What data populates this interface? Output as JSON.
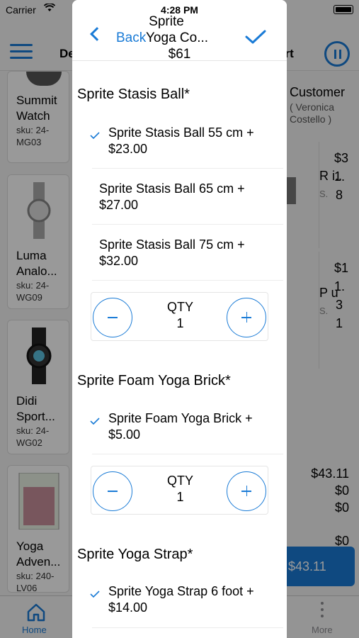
{
  "status_bar": {
    "carrier": "Carrier",
    "time": "4:28 PM"
  },
  "background": {
    "header": {
      "left_title_fragment": "De",
      "right_title_fragment": "art"
    },
    "products": [
      {
        "name_line1": "Summit",
        "name_line2": "Watch",
        "sku_line1": "sku: 24-",
        "sku_line2": "MG03"
      },
      {
        "name_line1": "Luma",
        "name_line2": "Analo...",
        "sku_line1": "sku: 24-",
        "sku_line2": "WG09"
      },
      {
        "name_line1": "Didi",
        "name_line2": "Sport...",
        "sku_line1": "sku: 24-",
        "sku_line2": "WG02"
      },
      {
        "name_line1": "Yoga",
        "name_line2": "Adven...",
        "sku_line1": "sku: 240-",
        "sku_line2": "LV06"
      }
    ],
    "customer": {
      "label": "Customer",
      "name_line1": "( Veronica",
      "name_line2": "Costello )"
    },
    "cart": {
      "item1_name": "R i..",
      "item1_sub": "S.",
      "item1_price": "$31.8",
      "item2_name": "P u",
      "item2_sub": "S.",
      "item2_price": "$11.31"
    },
    "totals": {
      "subtotal": "$43.11",
      "discount": "$0",
      "tax": "$0",
      "shipping": "$0"
    },
    "pay_button": "$43.11",
    "tabs": {
      "home": "Home",
      "more": "More"
    }
  },
  "sheet": {
    "back_label": "Back",
    "title_line1": "Sprite",
    "title_line2": "Yoga Co...",
    "title_price": "$61",
    "groups": [
      {
        "title": "Sprite Stasis Ball*",
        "options": [
          {
            "line1": "Sprite Stasis Ball 55 cm +",
            "line2": "$23.00",
            "selected": true
          },
          {
            "line1": "Sprite Stasis Ball 65 cm +",
            "line2": "$27.00",
            "selected": false
          },
          {
            "line1": "Sprite Stasis Ball 75 cm +",
            "line2": "$32.00",
            "selected": false
          }
        ],
        "qty_label": "QTY",
        "qty": "1"
      },
      {
        "title": "Sprite Foam Yoga Brick*",
        "options": [
          {
            "line1": "Sprite Foam Yoga Brick +",
            "line2": "$5.00",
            "selected": true
          }
        ],
        "qty_label": "QTY",
        "qty": "1"
      },
      {
        "title": "Sprite Yoga Strap*",
        "options": [
          {
            "line1": "Sprite Yoga Strap 6 foot +",
            "line2": "$14.00",
            "selected": true
          }
        ]
      }
    ]
  },
  "colors": {
    "accent": "#1a7bd6"
  }
}
